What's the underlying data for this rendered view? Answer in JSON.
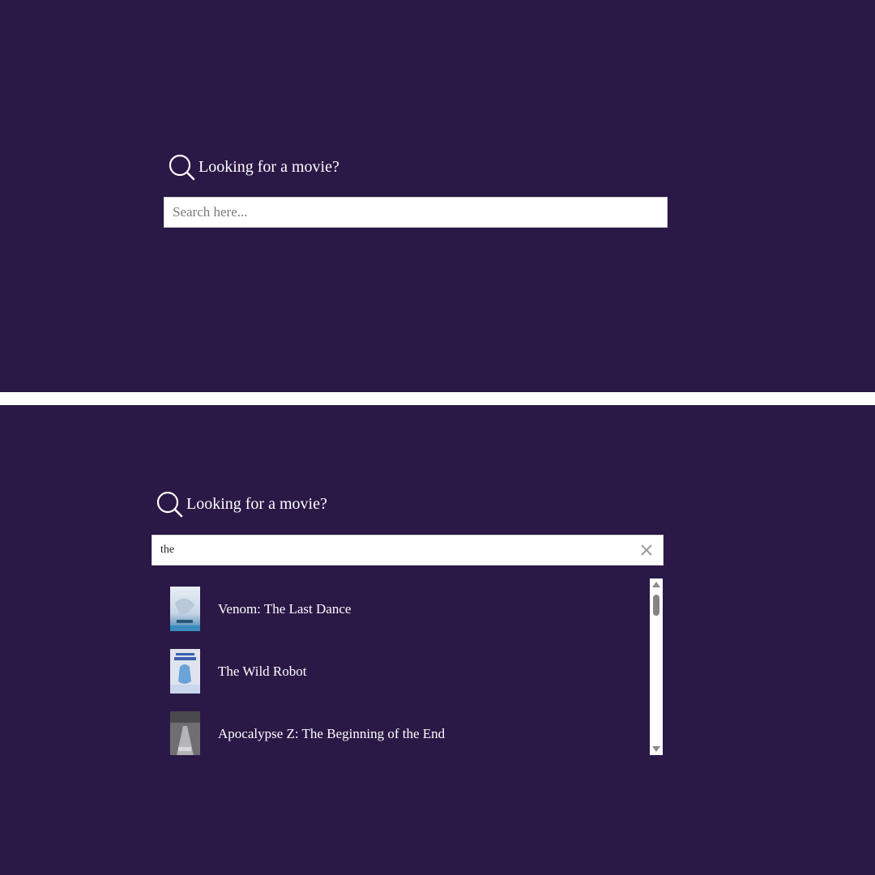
{
  "top_panel": {
    "heading": "Looking for a movie?",
    "search": {
      "placeholder": "Search here...",
      "value": ""
    }
  },
  "bottom_panel": {
    "heading": "Looking for a movie?",
    "search": {
      "placeholder": "Search here...",
      "value": "the"
    },
    "results": [
      {
        "title": "Venom: The Last Dance"
      },
      {
        "title": "The Wild Robot"
      },
      {
        "title": "Apocalypse Z: The Beginning of the End"
      }
    ]
  },
  "icons": {
    "search": "search-icon",
    "clear": "close-icon"
  },
  "colors": {
    "background": "#2a1846",
    "separator": "#ffffff",
    "text": "#ffffff",
    "input_bg": "#ffffff"
  }
}
